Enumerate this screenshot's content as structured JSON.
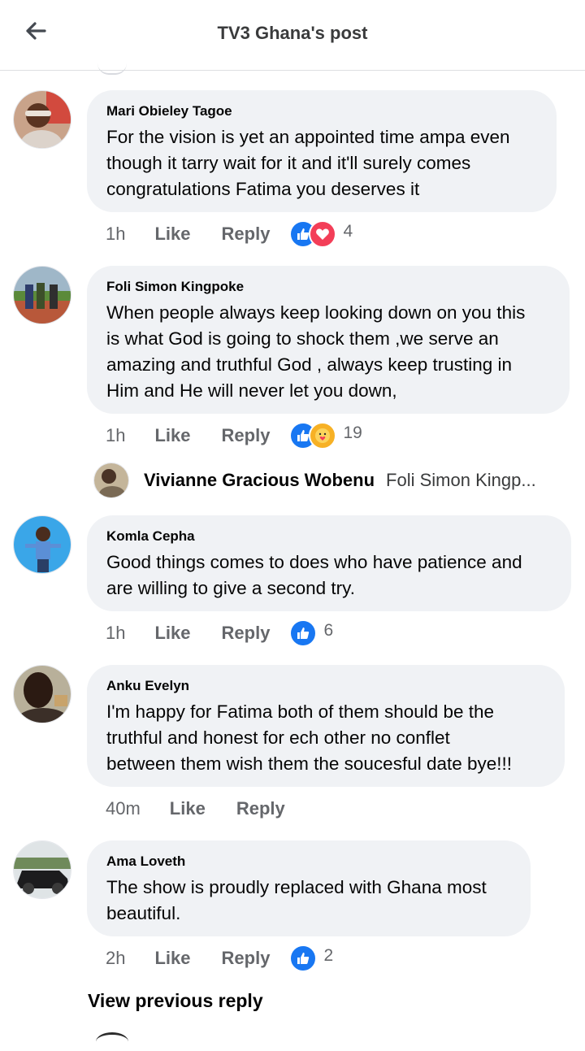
{
  "header": {
    "title": "TV3 Ghana's post",
    "back_icon": "arrow-left-icon"
  },
  "comments": [
    {
      "author": "Mari Obieley Tagoe",
      "lines": [
        "For the vision is yet an appointed time ampa even",
        "though it tarry wait for it and it'll surely comes",
        "congratulations Fatima you deserves it"
      ],
      "time": "1h",
      "like": "Like",
      "reply": "Reply",
      "reactions": [
        "like",
        "love"
      ],
      "reaction_count": "4"
    },
    {
      "author": "Foli Simon Kingpoke",
      "lines": [
        "When people always keep looking down on you this",
        "is what God is going to shock them ,we serve an",
        "amazing and truthful God , always keep trusting in",
        "Him and He will never let you down,"
      ],
      "time": "1h",
      "like": "Like",
      "reply": "Reply",
      "reactions": [
        "like",
        "care"
      ],
      "reaction_count": "19"
    },
    {
      "author": "Komla Cepha",
      "lines": [
        "Good things comes to does who have patience and",
        "are willing to give a second try."
      ],
      "time": "1h",
      "like": "Like",
      "reply": "Reply",
      "reactions": [
        "like"
      ],
      "reaction_count": "6"
    },
    {
      "author": "Anku Evelyn",
      "lines": [
        "I'm happy for Fatima both of them should be the",
        "truthful and honest for ech other no conflet",
        "between them wish them the soucesful date bye!!!"
      ],
      "time": "40m",
      "like": "Like",
      "reply": "Reply",
      "reactions": [],
      "reaction_count": ""
    },
    {
      "author": "Ama Loveth",
      "lines": [
        "The show is proudly replaced with Ghana most",
        "beautiful."
      ],
      "time": "2h",
      "like": "Like",
      "reply": "Reply",
      "reactions": [
        "like"
      ],
      "reaction_count": "2"
    }
  ],
  "reply_preview": {
    "author": "Vivianne Gracious Wobenu",
    "text": "Foli Simon Kingp..."
  },
  "view_previous": "View previous reply",
  "colors": {
    "like_blue": "#1877f2",
    "love_red": "#f33e58",
    "care_yellow": "#f7b125",
    "secondary_text": "#65676b",
    "bubble_bg": "#f0f2f5"
  }
}
